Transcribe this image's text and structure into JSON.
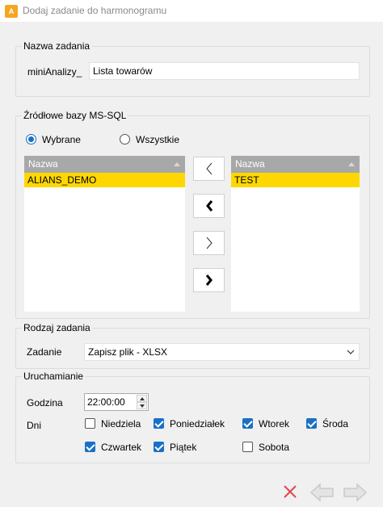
{
  "window": {
    "title": "Dodaj zadanie do harmonogramu",
    "icon": "app-icon"
  },
  "task_name": {
    "label": "Nazwa zadania",
    "prefix": "miniAnalizy_",
    "value": "Lista towarów"
  },
  "sources": {
    "label": "Źródłowe bazy MS-SQL",
    "radio_selected": "Wybrane",
    "radio_all": "Wszystkie",
    "left_list": {
      "header": "Nazwa",
      "items": [
        "ALIANS_DEMO"
      ]
    },
    "right_list": {
      "header": "Nazwa",
      "items": [
        "TEST"
      ]
    },
    "move_buttons": [
      "move-left-icon",
      "move-all-left-icon",
      "move-right-icon",
      "move-all-right-icon"
    ]
  },
  "task_type": {
    "label": "Rodzaj zadania",
    "field_label": "Zadanie",
    "value": "Zapisz plik - XLSX"
  },
  "schedule": {
    "label": "Uruchamianie",
    "time_label": "Godzina",
    "time_value": "22:00:00",
    "days_label": "Dni",
    "days": [
      {
        "name": "Niedziela",
        "checked": false
      },
      {
        "name": "Poniedziałek",
        "checked": true
      },
      {
        "name": "Wtorek",
        "checked": true
      },
      {
        "name": "Środa",
        "checked": true
      },
      {
        "name": "Czwartek",
        "checked": true
      },
      {
        "name": "Piątek",
        "checked": true
      },
      {
        "name": "Sobota",
        "checked": false
      }
    ]
  },
  "footer": {
    "icons": [
      "cancel-icon",
      "back-icon",
      "forward-icon"
    ],
    "accent": "#e0474c"
  },
  "colors": {
    "selection": "#ffd700",
    "list_header": "#a8a8a8",
    "accent": "#1a70c5"
  }
}
